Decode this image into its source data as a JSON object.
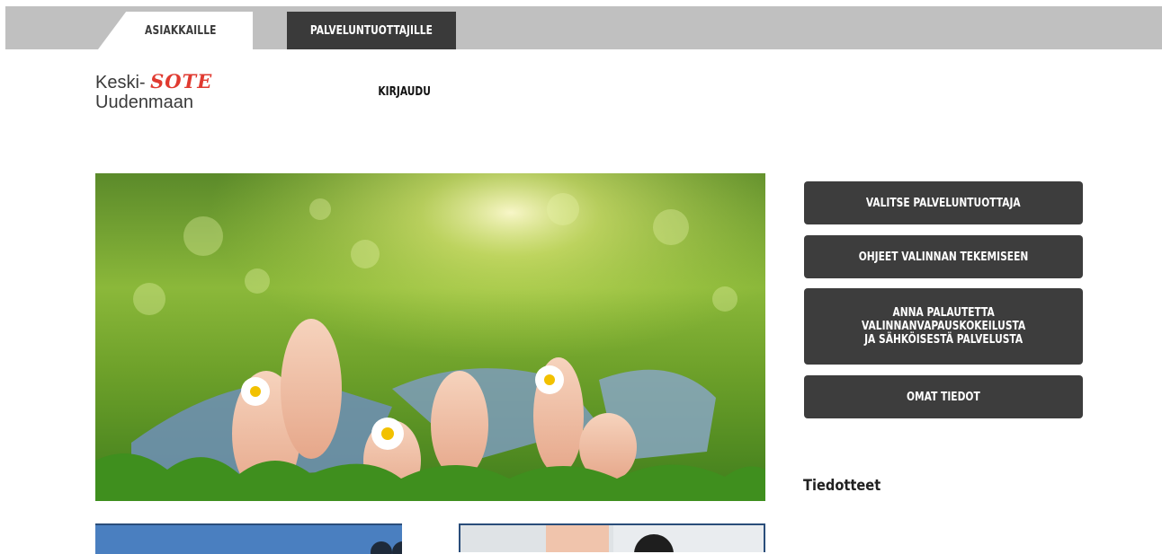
{
  "tabs": [
    {
      "label": "ASIAKKAILLE",
      "active": true
    },
    {
      "label": "PALVELUNTUOTTAJILLE",
      "active": false
    }
  ],
  "logo": {
    "line1": "Keski-",
    "brand": "SOTE",
    "line2": "Uudenmaan"
  },
  "header": {
    "login_label": "KIRJAUDU"
  },
  "hero": {
    "image": "children-feet-on-grass-photo"
  },
  "side_menu": [
    {
      "label": "VALITSE PALVELUNTUOTTAJA"
    },
    {
      "label": "OHJEET VALINNAN TEKEMISEEN"
    },
    {
      "label": "ANNA PALAUTETTA VALINNANVAPAUSKOKEILUSTA JA SÄHKÖISESTÄ PALVELUSTA"
    },
    {
      "label": "OMAT TIEDOT"
    }
  ],
  "news": {
    "heading": "Tiedotteet"
  },
  "colors": {
    "tabbar": "#c0c0c0",
    "dark": "#3d3d3d",
    "brand_red": "#e03a30"
  }
}
